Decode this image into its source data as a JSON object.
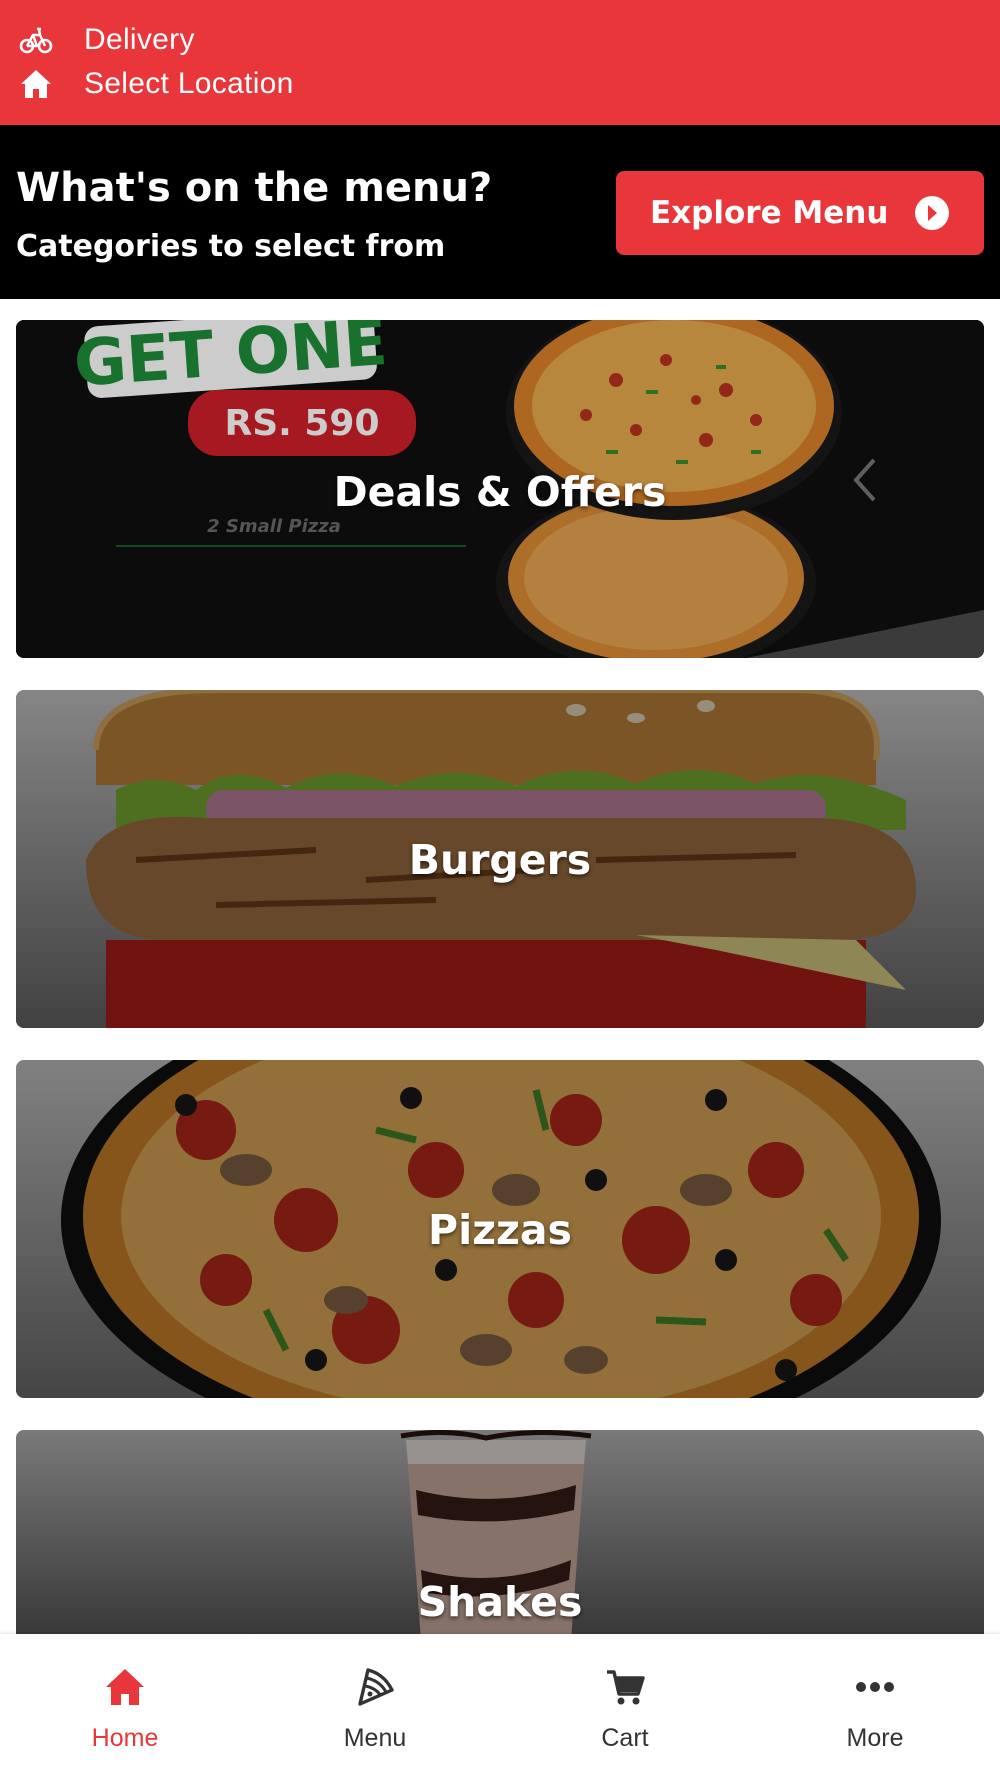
{
  "colors": {
    "brand_red": "#e8363a",
    "promo_bg": "#000000",
    "nav_active": "#e8363a",
    "nav_inactive": "#333333"
  },
  "header": {
    "mode_label": "Delivery",
    "mode_icon": "bicycle-icon",
    "location_label": "Select Location",
    "location_icon": "home-icon"
  },
  "promo": {
    "title": "What's on the menu?",
    "subtitle": "Categories to select from",
    "button_label": "Explore Menu",
    "button_icon": "arrow-circle-right-icon"
  },
  "deal_artwork": {
    "headline": "GET ONE",
    "price": "RS. 590",
    "caption": "2 Small Pizza"
  },
  "categories": [
    {
      "label": "Deals & Offers"
    },
    {
      "label": "Burgers"
    },
    {
      "label": "Pizzas"
    },
    {
      "label": "Shakes"
    }
  ],
  "bottom_nav": [
    {
      "label": "Home",
      "icon": "home-icon",
      "active": true
    },
    {
      "label": "Menu",
      "icon": "pizza-slice-icon",
      "active": false
    },
    {
      "label": "Cart",
      "icon": "cart-icon",
      "active": false
    },
    {
      "label": "More",
      "icon": "more-dots-icon",
      "active": false
    }
  ]
}
